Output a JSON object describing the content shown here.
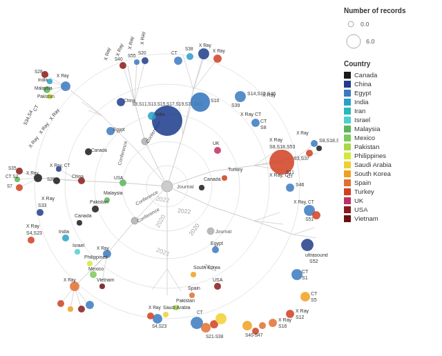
{
  "legend": {
    "size_title": "Number of records",
    "size_min": "0.0",
    "size_max": "6.0",
    "country_title": "Country",
    "countries": [
      {
        "name": "Canada",
        "color": "#1a1a1a"
      },
      {
        "name": "China",
        "color": "#1f3d8a"
      },
      {
        "name": "Egypt",
        "color": "#3a7abf"
      },
      {
        "name": "India",
        "color": "#29a0c8"
      },
      {
        "name": "Iran",
        "color": "#2ab8b8"
      },
      {
        "name": "Israel",
        "color": "#4bcfcf"
      },
      {
        "name": "Malaysia",
        "color": "#5ab55a"
      },
      {
        "name": "Mexico",
        "color": "#7dc95a"
      },
      {
        "name": "Pakistan",
        "color": "#a8d84a"
      },
      {
        "name": "Philippines",
        "color": "#d4e83a"
      },
      {
        "name": "Saudi Arabia",
        "color": "#f0d030"
      },
      {
        "name": "South Korea",
        "color": "#f0a020"
      },
      {
        "name": "Spain",
        "color": "#e07030"
      },
      {
        "name": "Turkey",
        "color": "#d04020"
      },
      {
        "name": "UK",
        "color": "#c03060"
      },
      {
        "name": "USA",
        "color": "#8b1a1a"
      },
      {
        "name": "Vietnam",
        "color": "#6b1010"
      }
    ]
  }
}
